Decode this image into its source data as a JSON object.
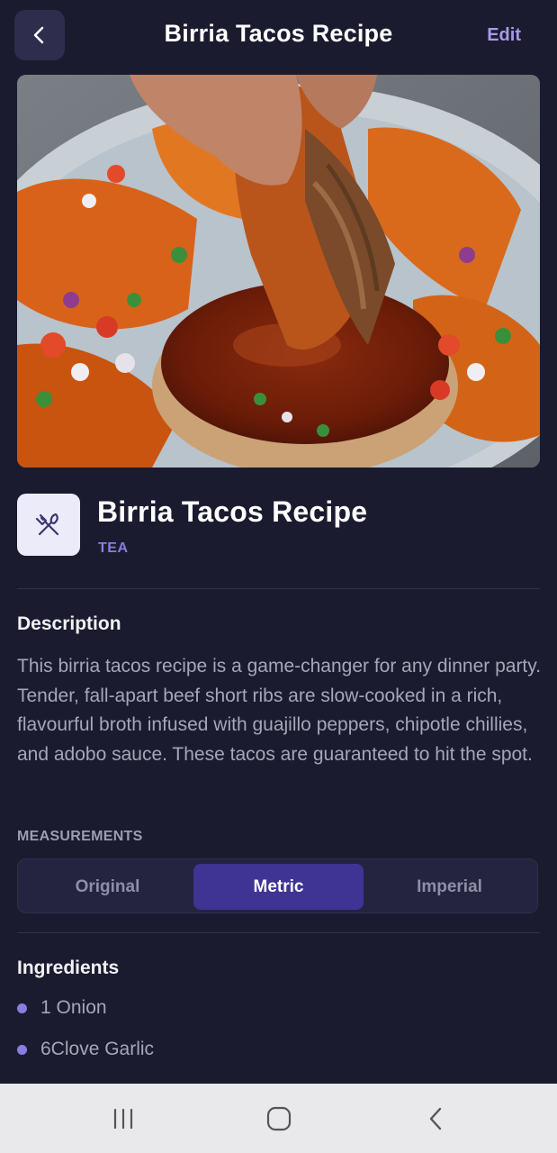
{
  "header": {
    "title": "Birria Tacos Recipe",
    "back_icon": "chevron-left-icon",
    "edit_label": "Edit"
  },
  "hero": {
    "image": "photo of birria tacos dipped in consommé"
  },
  "recipe": {
    "icon": "utensils-crossed-icon",
    "title": "Birria Tacos Recipe",
    "category": "TEA"
  },
  "description": {
    "heading": "Description",
    "text": "This birria tacos recipe is a game-changer for any dinner party. Tender, fall-apart beef short ribs are slow-cooked in a rich, flavourful broth infused with guajillo peppers, chipotle chillies, and adobo sauce. These tacos are guaranteed to hit the spot."
  },
  "measurements": {
    "label": "MEASUREMENTS",
    "options": [
      "Original",
      "Metric",
      "Imperial"
    ],
    "selected": "Metric"
  },
  "ingredients": {
    "heading": "Ingredients",
    "items": [
      "1 Onion",
      "6Clove Garlic"
    ]
  },
  "system_nav": {
    "recents_icon": "recents-icon",
    "home_icon": "home-icon",
    "back_icon": "back-icon"
  },
  "colors": {
    "background": "#1b1b2f",
    "accent": "#8a7ce0",
    "selected_segment": "#3f3494"
  }
}
